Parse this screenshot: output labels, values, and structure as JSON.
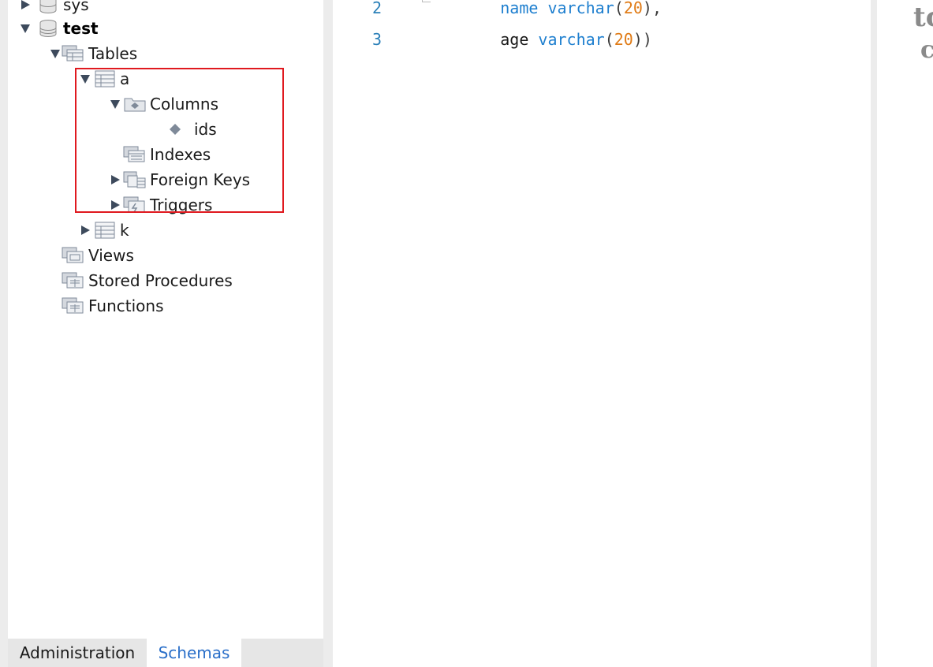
{
  "schema_tree": {
    "databases": [
      {
        "name": "sys",
        "expanded": false
      },
      {
        "name": "test",
        "expanded": true,
        "active": true
      }
    ],
    "tables_label": "Tables",
    "table_a": {
      "name": "a",
      "columns_label": "Columns",
      "columns": [
        "ids"
      ],
      "indexes_label": "Indexes",
      "foreign_keys_label": "Foreign Keys",
      "triggers_label": "Triggers"
    },
    "table_k": {
      "name": "k"
    },
    "views_label": "Views",
    "stored_procedures_label": "Stored Procedures",
    "functions_label": "Functions"
  },
  "bottom_tabs": {
    "administration": "Administration",
    "schemas": "Schemas",
    "active": "Schemas"
  },
  "editor": {
    "lines": [
      {
        "number": "2",
        "tokens": [
          {
            "text": "name",
            "kind": "kw"
          },
          {
            "text": " ",
            "kind": "plain"
          },
          {
            "text": "varchar",
            "kind": "kw"
          },
          {
            "text": "(",
            "kind": "pn"
          },
          {
            "text": "20",
            "kind": "num"
          },
          {
            "text": "),",
            "kind": "pn"
          }
        ]
      },
      {
        "number": "3",
        "tokens": [
          {
            "text": "age",
            "kind": "plain"
          },
          {
            "text": " ",
            "kind": "plain"
          },
          {
            "text": "varchar",
            "kind": "kw"
          },
          {
            "text": "(",
            "kind": "pn"
          },
          {
            "text": "20",
            "kind": "num"
          },
          {
            "text": "))",
            "kind": "pn"
          }
        ]
      }
    ]
  },
  "right_panel": {
    "snippet_1": "tc",
    "snippet_2": "c"
  },
  "colors": {
    "keyword": "#1e7fcf",
    "number": "#e07b16",
    "line_number": "#2a7fb8",
    "active_tab_text": "#2a6fc9",
    "highlight_box": "#e0191f"
  }
}
